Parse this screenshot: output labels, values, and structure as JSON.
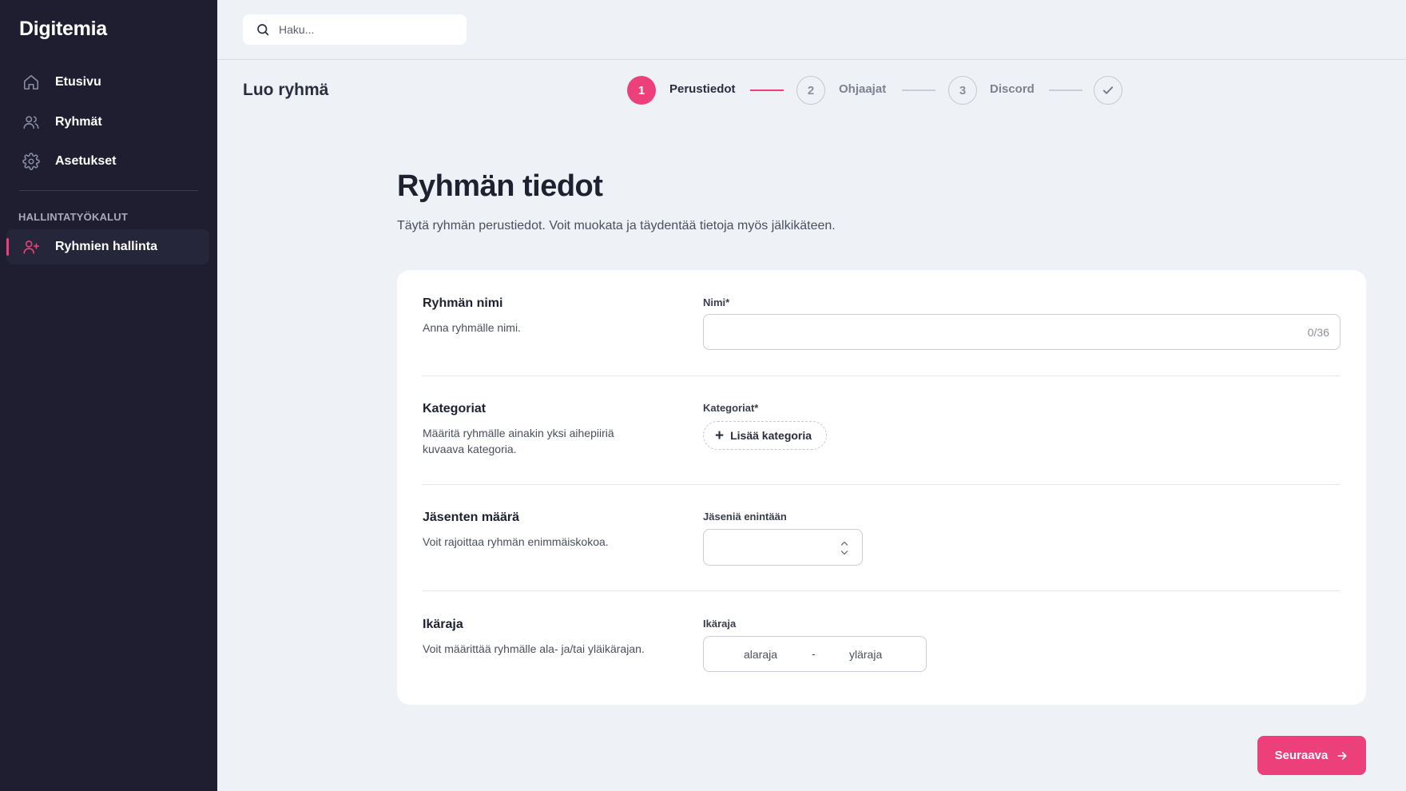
{
  "app": {
    "name": "Digitemia"
  },
  "sidebar": {
    "items": [
      {
        "label": "Etusivu",
        "icon": "home-icon"
      },
      {
        "label": "Ryhmät",
        "icon": "users-icon"
      },
      {
        "label": "Asetukset",
        "icon": "gear-icon"
      }
    ],
    "section_title": "HALLINTATYÖKALUT",
    "admin_items": [
      {
        "label": "Ryhmien hallinta",
        "icon": "user-plus-icon",
        "active": true
      }
    ]
  },
  "search": {
    "placeholder": "Haku..."
  },
  "page": {
    "title": "Luo ryhmä"
  },
  "stepper": {
    "steps": [
      {
        "number": "1",
        "label": "Perustiedot",
        "state": "active"
      },
      {
        "number": "2",
        "label": "Ohjaajat",
        "state": "pending"
      },
      {
        "number": "3",
        "label": "Discord",
        "state": "pending"
      },
      {
        "number": "",
        "label": "",
        "state": "done-check"
      }
    ]
  },
  "section": {
    "title": "Ryhmän tiedot",
    "subtitle": "Täytä ryhmän perustiedot. Voit muokata ja täydentää tietoja myös jälkikäteen."
  },
  "form": {
    "name": {
      "title": "Ryhmän nimi",
      "description": "Anna ryhmälle nimi.",
      "field_label": "Nimi*",
      "value": "",
      "counter": "0/36"
    },
    "categories": {
      "title": "Kategoriat",
      "description": "Määritä ryhmälle ainakin yksi aihepiiriä kuvaava kategoria.",
      "field_label": "Kategoriat*",
      "add_button": "Lisää kategoria"
    },
    "members": {
      "title": "Jäsenten määrä",
      "description": "Voit rajoittaa ryhmän enimmäiskokoa.",
      "field_label": "Jäseniä enintään",
      "value": ""
    },
    "age": {
      "title": "Ikäraja",
      "description": "Voit määrittää ryhmälle ala- ja/tai yläikärajan.",
      "field_label": "Ikäraja",
      "lower_placeholder": "alaraja",
      "separator": "-",
      "upper_placeholder": "yläraja"
    }
  },
  "actions": {
    "next_label": "Seuraava"
  },
  "colors": {
    "accent": "#ec407a",
    "sidebar_bg": "#1e1e30",
    "page_bg": "#eef2f6"
  }
}
